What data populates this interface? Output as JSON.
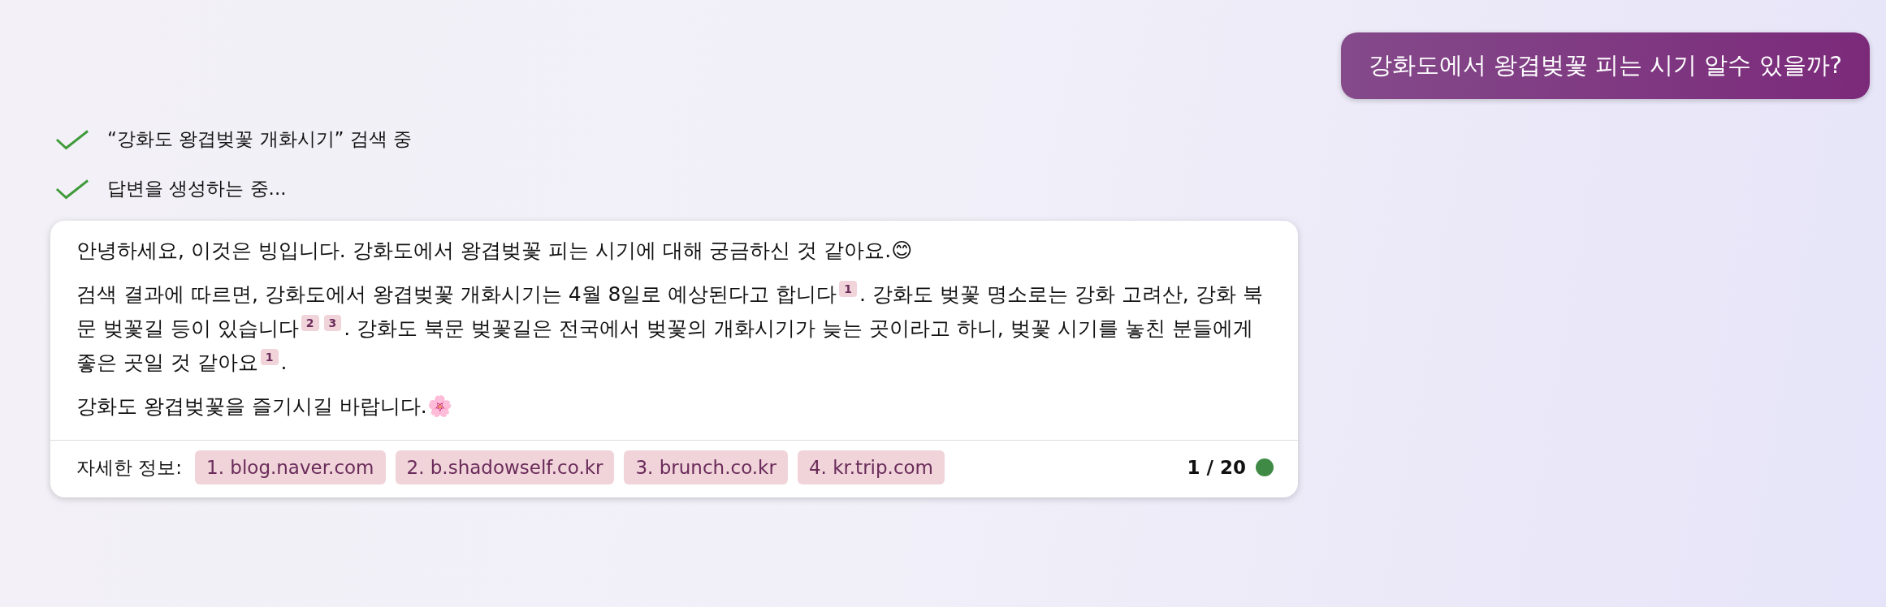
{
  "user_message": "강화도에서 왕겹벚꽃 피는 시기 알수 있을까?",
  "progress": [
    {
      "text": "“강화도 왕겹벚꽃 개화시기” 검색 중",
      "done": true
    },
    {
      "text": "답변을 생성하는 중...",
      "done": true
    }
  ],
  "answer": {
    "paragraphs": [
      [
        {
          "kind": "text",
          "text": "안녕하세요, 이것은 빙입니다. 강화도에서 왕겹벚꽃 피는 시기에 대해 궁금하신 것 같아요.😊"
        }
      ],
      [
        {
          "kind": "text",
          "text": "검색 결과에 따르면, 강화도에서 왕겹벚꽃 개화시기는 4월 8일로 예상된다고 합니다"
        },
        {
          "kind": "cite",
          "text": "1"
        },
        {
          "kind": "text",
          "text": ". 강화도 벚꽃 명소로는 강화 고려산, 강화 북문 벚꽃길 등이 있습니다"
        },
        {
          "kind": "cite",
          "text": "2"
        },
        {
          "kind": "cite",
          "text": "3"
        },
        {
          "kind": "text",
          "text": ". 강화도 북문 벚꽃길은 전국에서 벚꽃의 개화시기가 늦는 곳이라고 하니, 벚꽃 시기를 놓친 분들에게 좋은 곳일 것 같아요"
        },
        {
          "kind": "cite",
          "text": "1"
        },
        {
          "kind": "text",
          "text": "."
        }
      ],
      [
        {
          "kind": "text",
          "text": "강화도 왕겹벚꽃을 즐기시길 바랍니다.🌸"
        }
      ]
    ],
    "sources_label": "자세한 정보:",
    "sources": [
      "1. blog.naver.com",
      "2. b.shadowself.co.kr",
      "3. brunch.co.kr",
      "4. kr.trip.com"
    ],
    "counter": "1 / 20"
  }
}
